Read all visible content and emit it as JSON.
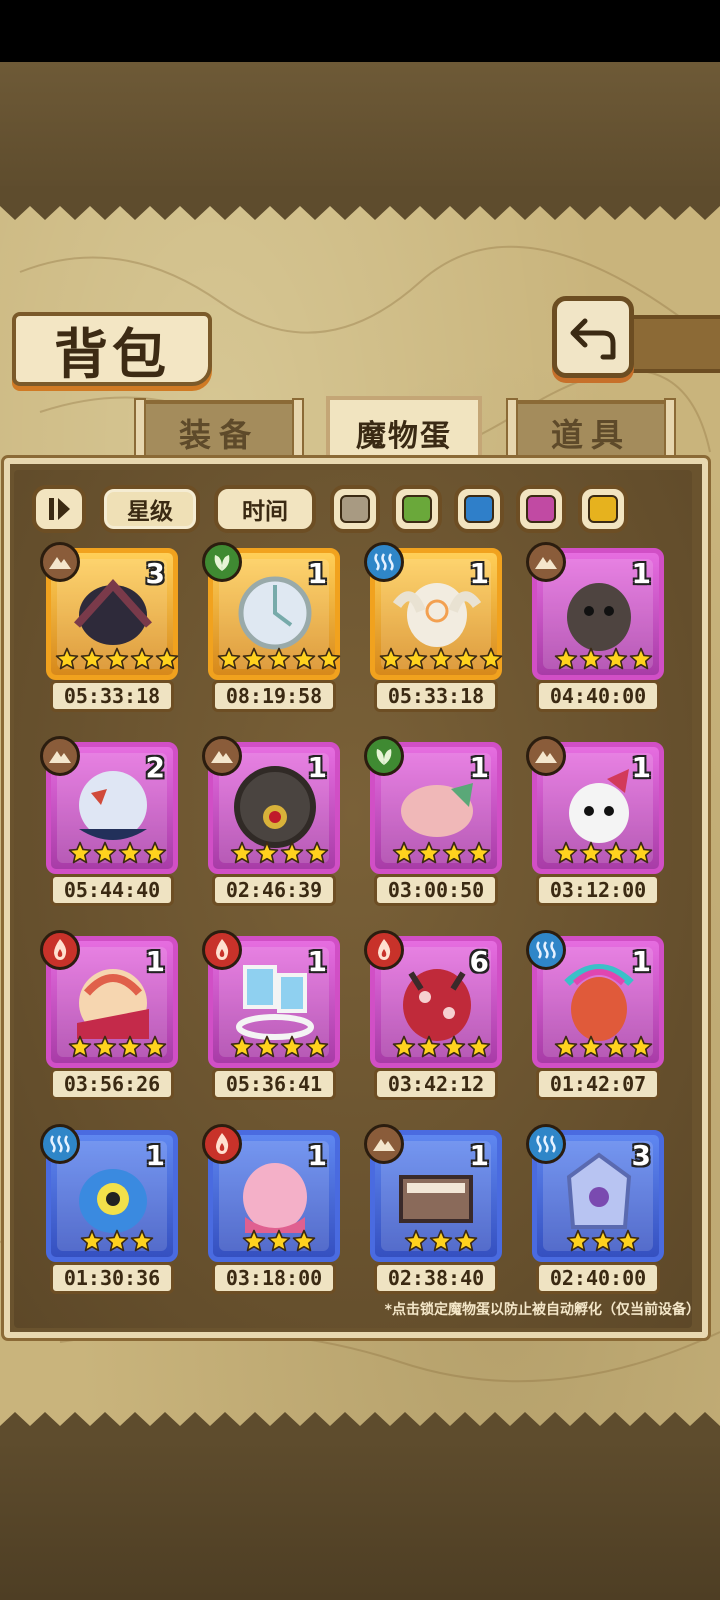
{
  "title": "背包",
  "tabs": [
    {
      "label": "装备",
      "active": false
    },
    {
      "label": "魔物蛋",
      "active": true
    },
    {
      "label": "道具",
      "active": false
    }
  ],
  "filters": {
    "star_label": "星级",
    "time_label": "时间",
    "swatches": [
      "#a89a82",
      "#6aa83a",
      "#2f7fc9",
      "#c14aa3",
      "#e6b21e"
    ]
  },
  "elements": {
    "earth": {
      "icon": "mountain-icon",
      "color": "#8a5c3a"
    },
    "grass": {
      "icon": "leaf-icon",
      "color": "#3f8a32"
    },
    "water": {
      "icon": "wave-icon",
      "color": "#2f86c8"
    },
    "fire": {
      "icon": "flame-icon",
      "color": "#c8322a"
    }
  },
  "eggs": [
    {
      "element": "earth",
      "count": "3",
      "stars": 5,
      "timer": "05:33:18",
      "rarity": "gold"
    },
    {
      "element": "grass",
      "count": "1",
      "stars": 5,
      "timer": "08:19:58",
      "rarity": "gold"
    },
    {
      "element": "water",
      "count": "1",
      "stars": 5,
      "timer": "05:33:18",
      "rarity": "gold"
    },
    {
      "element": "earth",
      "count": "1",
      "stars": 4,
      "timer": "04:40:00",
      "rarity": "purple"
    },
    {
      "element": "earth",
      "count": "2",
      "stars": 4,
      "timer": "05:44:40",
      "rarity": "purple"
    },
    {
      "element": "earth",
      "count": "1",
      "stars": 4,
      "timer": "02:46:39",
      "rarity": "purple"
    },
    {
      "element": "grass",
      "count": "1",
      "stars": 4,
      "timer": "03:00:50",
      "rarity": "purple"
    },
    {
      "element": "earth",
      "count": "1",
      "stars": 4,
      "timer": "03:12:00",
      "rarity": "purple"
    },
    {
      "element": "fire",
      "count": "1",
      "stars": 4,
      "timer": "03:56:26",
      "rarity": "purple"
    },
    {
      "element": "fire",
      "count": "1",
      "stars": 4,
      "timer": "05:36:41",
      "rarity": "purple"
    },
    {
      "element": "fire",
      "count": "6",
      "stars": 4,
      "timer": "03:42:12",
      "rarity": "purple"
    },
    {
      "element": "water",
      "count": "1",
      "stars": 4,
      "timer": "01:42:07",
      "rarity": "purple"
    },
    {
      "element": "water",
      "count": "1",
      "stars": 3,
      "timer": "01:30:36",
      "rarity": "blue"
    },
    {
      "element": "fire",
      "count": "1",
      "stars": 3,
      "timer": "03:18:00",
      "rarity": "blue"
    },
    {
      "element": "earth",
      "count": "1",
      "stars": 3,
      "timer": "02:38:40",
      "rarity": "blue"
    },
    {
      "element": "water",
      "count": "3",
      "stars": 3,
      "timer": "02:40:00",
      "rarity": "blue"
    }
  ],
  "footnote": "*点击锁定魔物蛋以防止被自动孵化（仅当前设备）"
}
